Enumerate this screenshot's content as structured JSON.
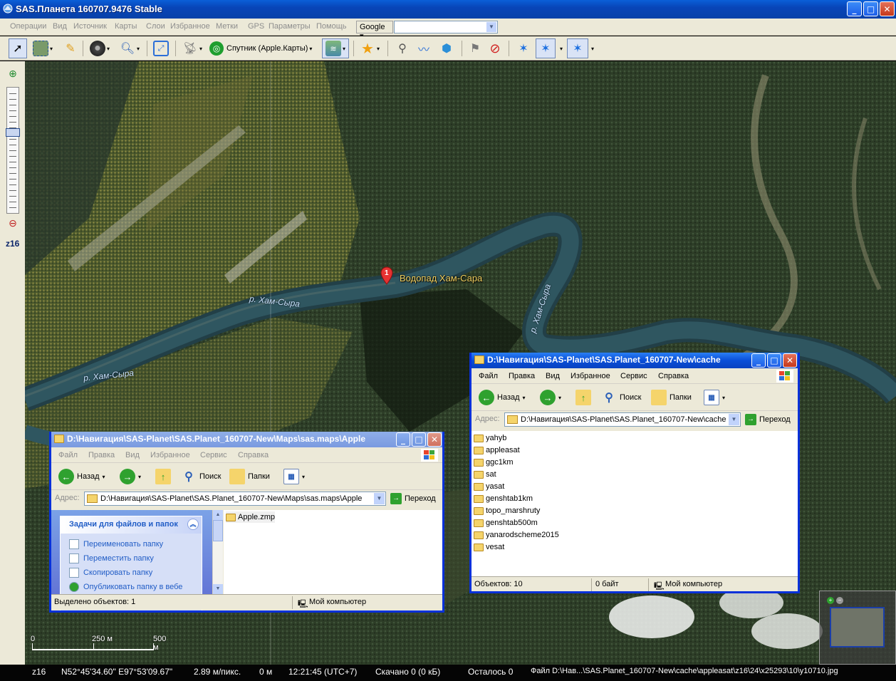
{
  "window": {
    "title": "SAS.Планета 160707.9476 Stable"
  },
  "menu": [
    "Операции",
    "Вид",
    "Источник",
    "Карты",
    "Слои",
    "Избранное",
    "Метки",
    "GPS",
    "Параметры",
    "Помощь"
  ],
  "search": {
    "provider": "Google",
    "value": ""
  },
  "toolbar": {
    "map_source": "Спутник (Apple.Карты)"
  },
  "zoom": {
    "level": "z16"
  },
  "map": {
    "poi": {
      "number": "1",
      "label": "Водопад Хам-Сара"
    },
    "river_labels": [
      "р. Хам-Сыра",
      "р. Хам-Сыра",
      "р. Хам-Сыра"
    ],
    "scale": {
      "ticks": [
        "0",
        "250 м",
        "500 м"
      ]
    }
  },
  "status": {
    "zoom": "z16",
    "coords": "N52°45'34.60\"  E97°53'09.67\"",
    "resolution": "2.89 м/пикс.",
    "altitude": "0 м",
    "time": "12:21:45 (UTC+7)",
    "downloaded": "Скачано 0 (0 кБ)",
    "remaining": "Осталось 0",
    "file": "Файл D:\\Нав...\\SAS.Planet_160707-New\\cache\\appleasat\\z16\\24\\x25293\\10\\y10710.jpg"
  },
  "explorer_cache": {
    "title": "D:\\Навигация\\SAS-Planet\\SAS.Planet_160707-New\\cache",
    "menu": [
      "Файл",
      "Правка",
      "Вид",
      "Избранное",
      "Сервис",
      "Справка"
    ],
    "back": "Назад",
    "search": "Поиск",
    "folders": "Папки",
    "address_label": "Адрес:",
    "address": "D:\\Навигация\\SAS-Planet\\SAS.Planet_160707-New\\cache",
    "go": "Переход",
    "items": [
      "yahyb",
      "appleasat",
      "ggc1km",
      "sat",
      "yasat",
      "genshtab1km",
      "topo_marshruty",
      "genshtab500m",
      "yanarodscheme2015",
      "vesat"
    ],
    "status_count": "Объектов: 10",
    "status_size": "0 байт",
    "status_location": "Мой компьютер"
  },
  "explorer_apple": {
    "title": "D:\\Навигация\\SAS-Planet\\SAS.Planet_160707-New\\Maps\\sas.maps\\Apple",
    "menu": [
      "Файл",
      "Правка",
      "Вид",
      "Избранное",
      "Сервис",
      "Справка"
    ],
    "back": "Назад",
    "search": "Поиск",
    "folders": "Папки",
    "address_label": "Адрес:",
    "address": "D:\\Навигация\\SAS-Planet\\SAS.Planet_160707-New\\Maps\\sas.maps\\Apple",
    "go": "Переход",
    "task_header": "Задачи для файлов и папок",
    "tasks": [
      "Переименовать папку",
      "Переместить папку",
      "Скопировать папку",
      "Опубликовать папку в вебе"
    ],
    "items": [
      "Apple.zmp"
    ],
    "status_selected": "Выделено объектов: 1",
    "status_location": "Мой компьютер"
  },
  "colors": {
    "xp_blue": "#0a4fd8",
    "xp_face": "#ece9d8",
    "poi_label": "#f0d060",
    "river_label": "#c8e2ff"
  }
}
